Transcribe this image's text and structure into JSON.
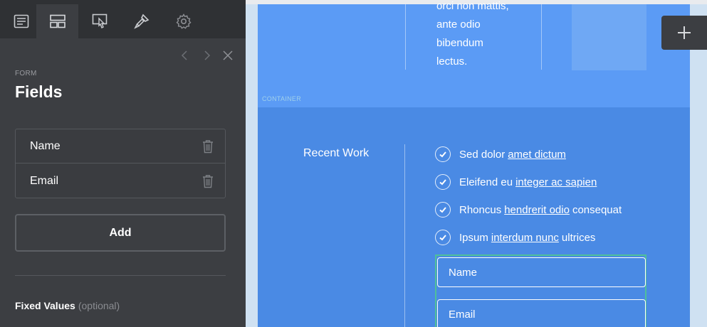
{
  "toolbar": {
    "tabs": [
      {
        "icon": "document-icon",
        "label": ""
      },
      {
        "icon": "layout-icon",
        "label": ""
      },
      {
        "icon": "pointer-icon",
        "label": ""
      },
      {
        "icon": "brush-icon",
        "label": ""
      },
      {
        "icon": "gear-icon",
        "label": ""
      }
    ],
    "active_tab_index": 1
  },
  "panel": {
    "eyebrow": "FORM",
    "title": "Fields",
    "fields": [
      {
        "label": "Name"
      },
      {
        "label": "Email"
      }
    ],
    "add_label": "Add",
    "fixed_values_label": "Fixed Values",
    "fixed_values_hint": "(optional)"
  },
  "canvas": {
    "paragraph_lines": [
      "orci non mattis,",
      "ante odio",
      "bibendum",
      "lectus."
    ],
    "section_tag": "CONTAINER",
    "recent_work": "Recent Work",
    "checklist": [
      {
        "before": "Sed dolor",
        "link": "amet dictum",
        "after": ""
      },
      {
        "before": "Eleifend eu",
        "link": "integer ac sapien",
        "after": ""
      },
      {
        "before": "Rhoncus",
        "link": "hendrerit odio",
        "after": "consequat"
      },
      {
        "before": "Ipsum",
        "link": "interdum nunc",
        "after": "ultrices"
      }
    ],
    "form_inputs": [
      {
        "placeholder": "Name"
      },
      {
        "placeholder": "Email"
      }
    ]
  },
  "colors": {
    "panel_bg": "#3c3e42",
    "tabbar_bg": "#2f3134",
    "section_light": "#5b9bf5",
    "section_dark": "#4a8ae4",
    "form_outline": "#4fbf9a"
  }
}
